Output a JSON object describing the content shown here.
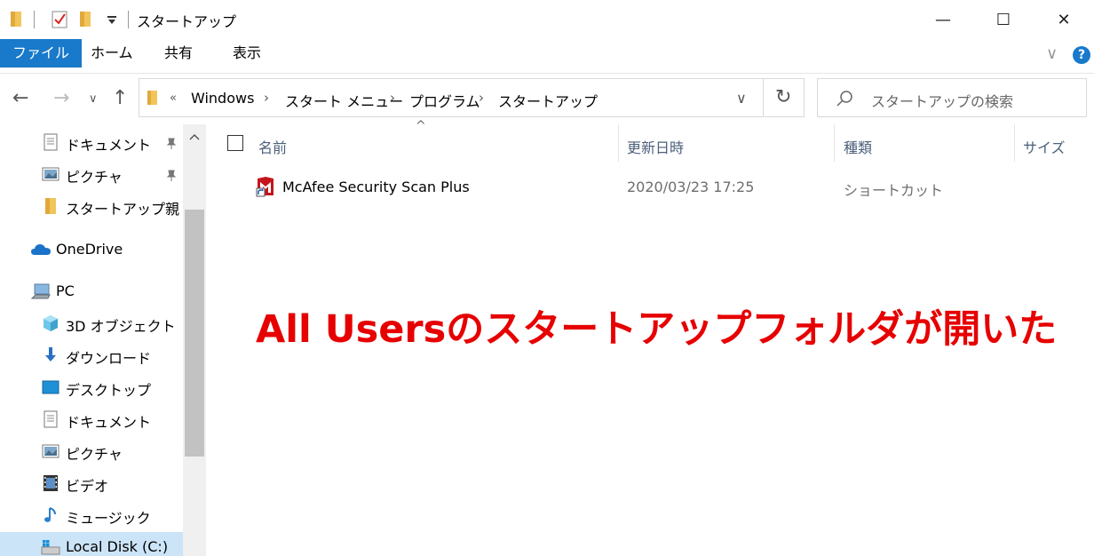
{
  "window": {
    "title": "スタートアップ",
    "minimize": "—",
    "maximize": "☐",
    "close": "✕"
  },
  "ribbon": {
    "tabs": [
      "ファイル",
      "ホーム",
      "共有",
      "表示"
    ],
    "collapse_glyph": "∨",
    "help_glyph": "?"
  },
  "nav_buttons": {
    "back": "←",
    "forward": "→",
    "recent": "∨",
    "up": "↑"
  },
  "address": {
    "overflow": "«",
    "crumbs": [
      "Windows",
      "スタート メニュー",
      "プログラム",
      "スタートアップ"
    ],
    "separator": "›",
    "dropdown": "∨",
    "refresh": "↻"
  },
  "search": {
    "placeholder": "スタートアップの検索"
  },
  "nav_pane": {
    "quick_access": [
      {
        "label": "ドキュメント",
        "icon": "document-icon",
        "pinned": true
      },
      {
        "label": "ピクチャ",
        "icon": "picture-icon",
        "pinned": true
      },
      {
        "label": "スタートアップ",
        "suffix": "親",
        "icon": "folder-icon",
        "pinned": false
      }
    ],
    "onedrive": "OneDrive",
    "pc": "PC",
    "pc_items": [
      {
        "label": "3D オブジェクト",
        "icon": "3d-objects-icon"
      },
      {
        "label": "ダウンロード",
        "icon": "download-icon"
      },
      {
        "label": "デスクトップ",
        "icon": "desktop-icon"
      },
      {
        "label": "ドキュメント",
        "icon": "document-icon"
      },
      {
        "label": "ピクチャ",
        "icon": "picture-icon"
      },
      {
        "label": "ビデオ",
        "icon": "video-icon"
      },
      {
        "label": "ミュージック",
        "icon": "music-icon"
      },
      {
        "label": "Local Disk (C:)",
        "icon": "drive-icon",
        "selected": true
      }
    ]
  },
  "columns": [
    "名前",
    "更新日時",
    "種類",
    "サイズ"
  ],
  "sort_glyph": "^",
  "files": [
    {
      "name": "McAfee Security Scan Plus",
      "modified": "2020/03/23 17:25",
      "type": "ショートカット",
      "size": ""
    }
  ],
  "annotation": "All Usersのスタートアップフォルダが開いた",
  "colors": {
    "accent": "#1979ca",
    "annotation": "#e60000",
    "folder": "#f2c55c"
  }
}
